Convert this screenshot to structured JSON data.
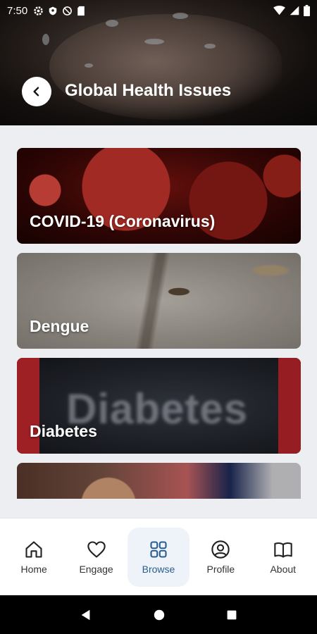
{
  "status_bar": {
    "time": "7:50",
    "left_icons": [
      "gear-icon",
      "shield-icon",
      "no-sync-icon",
      "sd-card-icon"
    ],
    "right_icons": [
      "wifi-icon",
      "signal-icon",
      "battery-icon"
    ]
  },
  "header": {
    "title": "Global Health Issues",
    "back_icon": "chevron-left-icon"
  },
  "cards": [
    {
      "label": "COVID-19 (Coronavirus)"
    },
    {
      "label": "Dengue"
    },
    {
      "label": "Diabetes",
      "image_text": "Diabetes"
    },
    {
      "label": ""
    }
  ],
  "bottom_nav": {
    "items": [
      {
        "label": "Home",
        "icon": "home-icon",
        "active": false
      },
      {
        "label": "Engage",
        "icon": "heart-icon",
        "active": false
      },
      {
        "label": "Browse",
        "icon": "grid-icon",
        "active": true
      },
      {
        "label": "Profile",
        "icon": "user-circle-icon",
        "active": false
      },
      {
        "label": "About",
        "icon": "book-icon",
        "active": false
      }
    ]
  },
  "colors": {
    "accent": "#2a5d8f",
    "active_bg": "#edf3f8",
    "page_bg": "#eceef2"
  }
}
